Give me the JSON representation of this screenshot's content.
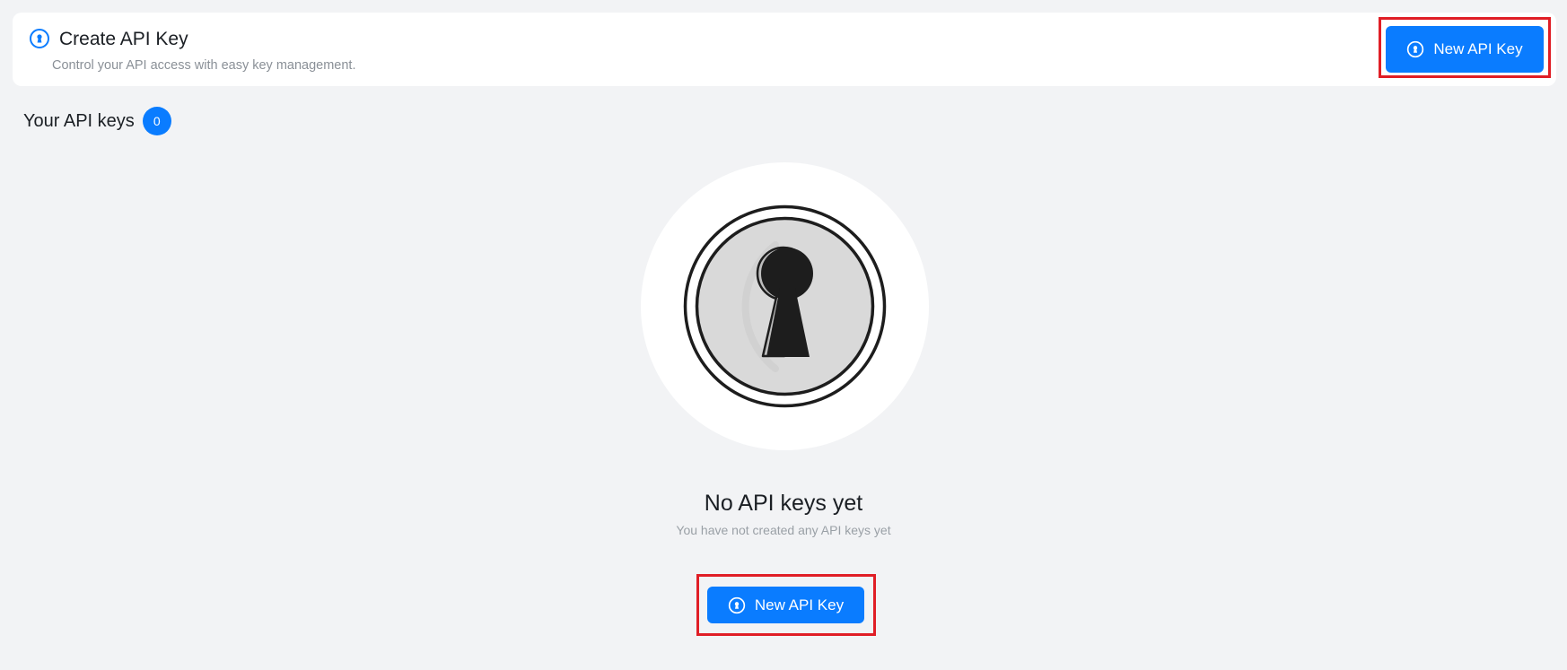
{
  "header": {
    "title": "Create API Key",
    "subtitle": "Control your API access with easy key management.",
    "icon": "key-badge-icon",
    "new_key_button_label": "New API Key"
  },
  "keys_section": {
    "title": "Your API keys",
    "count": "0"
  },
  "empty_state": {
    "illustration": "keyhole-icon",
    "title": "No API keys yet",
    "subtitle": "You have not created any API keys yet",
    "new_key_button_label": "New API Key"
  },
  "colors": {
    "accent": "#0a7cff",
    "background": "#f2f3f5",
    "card": "#ffffff",
    "highlight": "#e01e26"
  }
}
